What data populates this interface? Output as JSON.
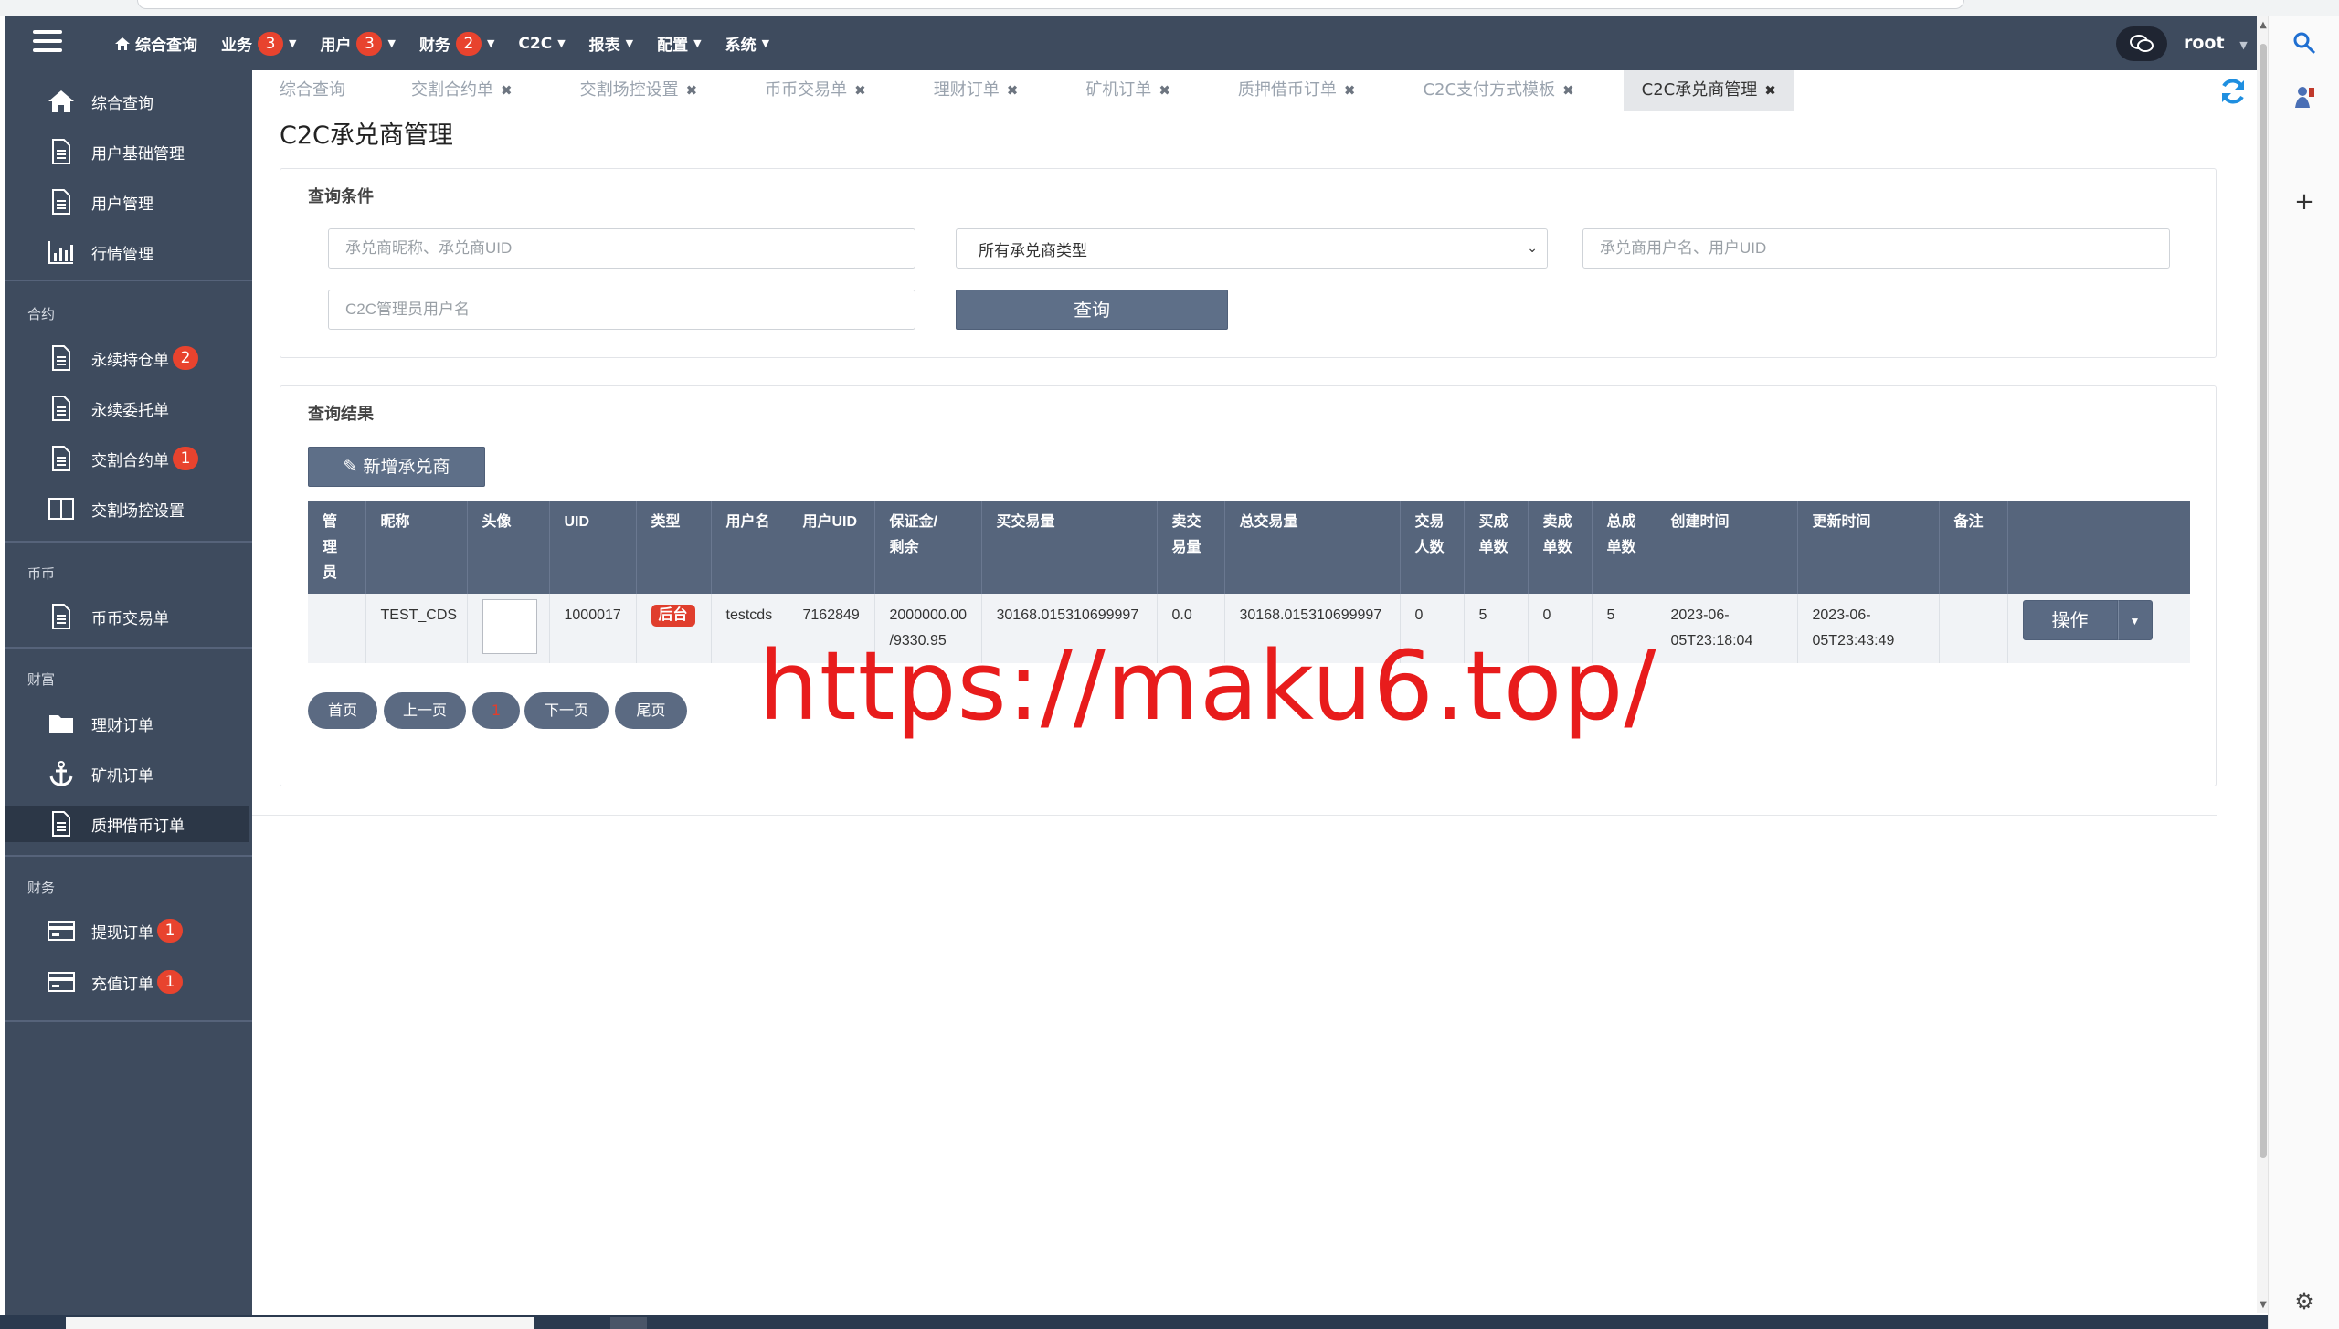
{
  "header": {
    "nav": [
      {
        "label": "综合查询",
        "icon": "home-icon"
      },
      {
        "label": "业务",
        "badge": "3",
        "caret": true
      },
      {
        "label": "用户",
        "badge": "3",
        "caret": true
      },
      {
        "label": "财务",
        "badge": "2",
        "caret": true
      },
      {
        "label": "C2C",
        "caret": true
      },
      {
        "label": "报表",
        "caret": true
      },
      {
        "label": "配置",
        "caret": true
      },
      {
        "label": "系统",
        "caret": true
      }
    ],
    "user": "root"
  },
  "sidebar": {
    "items": [
      {
        "label": "综合查询",
        "icon": "home-icon"
      },
      {
        "label": "用户基础管理",
        "icon": "document-icon"
      },
      {
        "label": "用户管理",
        "icon": "document-icon"
      },
      {
        "label": "行情管理",
        "icon": "bar-chart-icon"
      }
    ],
    "groups": [
      {
        "title": "合约",
        "items": [
          {
            "label": "永续持仓单",
            "icon": "document-icon",
            "badge": "2"
          },
          {
            "label": "永续委托单",
            "icon": "document-icon"
          },
          {
            "label": "交割合约单",
            "icon": "document-icon",
            "badge": "1"
          },
          {
            "label": "交割场控设置",
            "icon": "columns-icon"
          }
        ]
      },
      {
        "title": "币币",
        "items": [
          {
            "label": "币币交易单",
            "icon": "document-icon"
          }
        ]
      },
      {
        "title": "财富",
        "items": [
          {
            "label": "理财订单",
            "icon": "folder-icon"
          },
          {
            "label": "矿机订单",
            "icon": "anchor-icon"
          },
          {
            "label": "质押借币订单",
            "icon": "document-icon",
            "active": true
          }
        ]
      },
      {
        "title": "财务",
        "items": [
          {
            "label": "提现订单",
            "icon": "card-icon",
            "badge": "1"
          },
          {
            "label": "充值订单",
            "icon": "card-icon",
            "badge": "1"
          }
        ]
      }
    ]
  },
  "tabs": [
    {
      "label": "综合查询",
      "closable": false
    },
    {
      "label": "交割合约单",
      "closable": true
    },
    {
      "label": "交割场控设置",
      "closable": true
    },
    {
      "label": "币币交易单",
      "closable": true
    },
    {
      "label": "理财订单",
      "closable": true
    },
    {
      "label": "矿机订单",
      "closable": true
    },
    {
      "label": "质押借币订单",
      "closable": true
    },
    {
      "label": "C2C支付方式模板",
      "closable": true
    },
    {
      "label": "C2C承兑商管理",
      "closable": true,
      "active": true
    }
  ],
  "page": {
    "title": "C2C承兑商管理",
    "query": {
      "title": "查询条件",
      "merchant_placeholder": "承兑商昵称、承兑商UID",
      "type_select_value": "所有承兑商类型",
      "user_placeholder": "承兑商用户名、用户UID",
      "admin_placeholder": "C2C管理员用户名",
      "search_label": "查询"
    },
    "results": {
      "title": "查询结果",
      "add_label": "新增承兑商",
      "columns": [
        "管理员",
        "昵称",
        "头像",
        "UID",
        "类型",
        "用户名",
        "用户UID",
        "保证金/剩余",
        "买交易量",
        "卖交易量",
        "总交易量",
        "交易人数",
        "买成单数",
        "卖成单数",
        "总成单数",
        "创建时间",
        "更新时间",
        "备注",
        ""
      ],
      "rows": [
        {
          "admin": "",
          "nickname": "TEST_CDS",
          "uid": "1000017",
          "type": "后台",
          "username": "testcds",
          "user_uid": "7162849",
          "deposit": "2000000.00",
          "remaining": "/9330.95",
          "buy_volume": "30168.015310699997",
          "sell_volume": "0.0",
          "total_volume": "30168.015310699997",
          "traders": "0",
          "buy_orders": "5",
          "sell_orders": "0",
          "total_orders": "5",
          "created_a": "2023-06-",
          "created_b": "05T23:18:04",
          "updated_a": "2023-06-",
          "updated_b": "05T23:43:49",
          "remark": "",
          "action_label": "操作"
        }
      ]
    },
    "pager": {
      "first": "首页",
      "prev": "上一页",
      "current": "1",
      "next": "下一页",
      "last": "尾页"
    }
  },
  "watermark": "https://maku6.top/",
  "colors": {
    "sidebar_bg": "#3e4b5e",
    "table_header": "#56657c",
    "badge": "#e8432e",
    "accent_blue": "#1f6fd1"
  }
}
